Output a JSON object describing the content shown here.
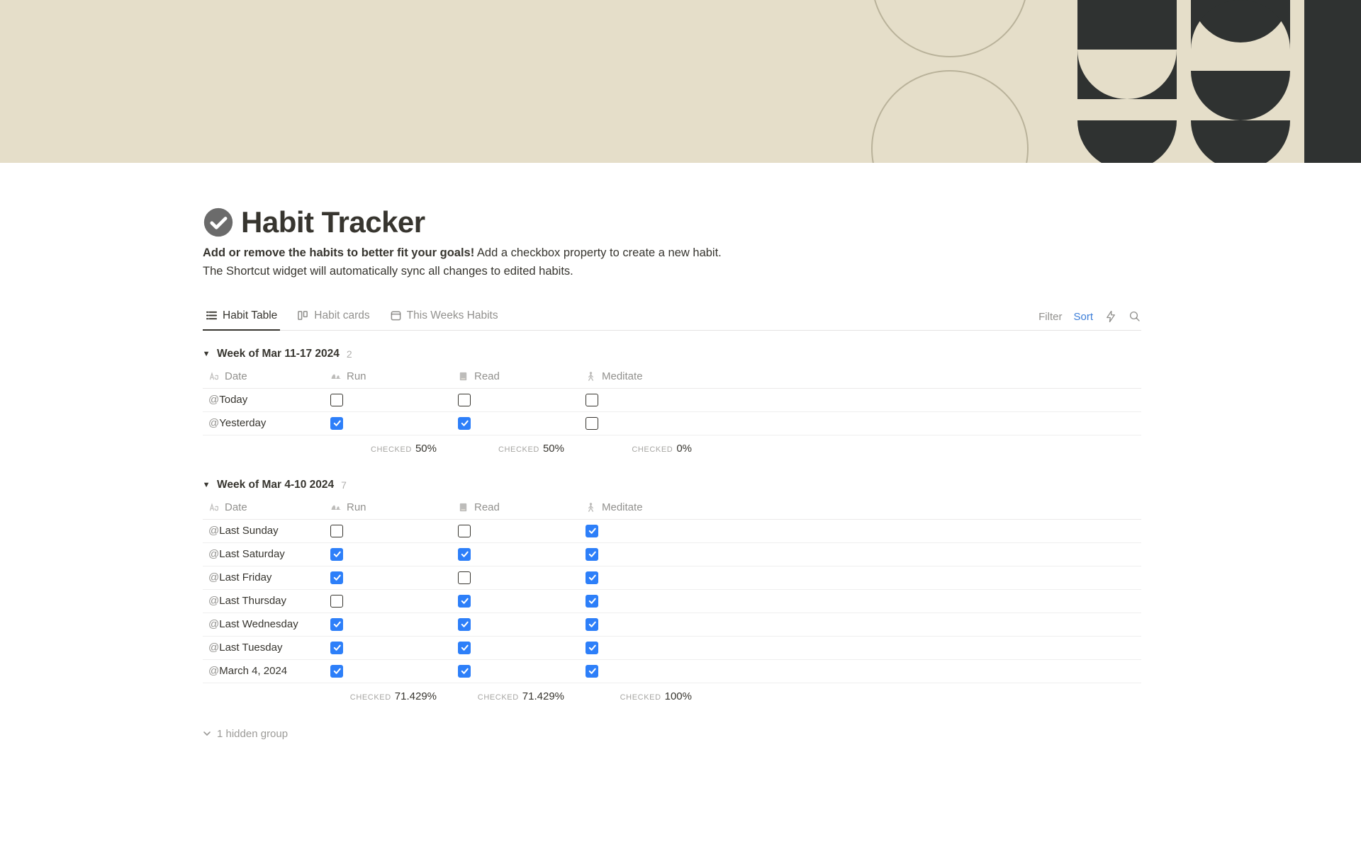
{
  "page": {
    "title": "Habit Tracker",
    "desc_bold": "Add or remove the habits to better fit your goals!",
    "desc_rest": " Add a checkbox property to create a new habit.",
    "desc_line2": "The Shortcut widget will automatically sync all changes to edited habits."
  },
  "tabs": [
    {
      "label": "Habit Table",
      "active": true,
      "icon": "list"
    },
    {
      "label": "Habit cards",
      "active": false,
      "icon": "board"
    },
    {
      "label": "This Weeks Habits",
      "active": false,
      "icon": "calendar"
    }
  ],
  "actions": {
    "filter": "Filter",
    "sort": "Sort"
  },
  "columns": {
    "date": "Date",
    "run": "Run",
    "read": "Read",
    "meditate": "Meditate"
  },
  "summary_label": "CHECKED",
  "hidden_group_text": "1 hidden group",
  "groups": [
    {
      "title": "Week of Mar 11-17 2024",
      "count": "2",
      "rows": [
        {
          "date": "Today",
          "run": false,
          "read": false,
          "meditate": false
        },
        {
          "date": "Yesterday",
          "run": true,
          "read": true,
          "meditate": false
        }
      ],
      "summary": {
        "run": "50%",
        "read": "50%",
        "meditate": "0%"
      }
    },
    {
      "title": "Week of Mar 4-10 2024",
      "count": "7",
      "rows": [
        {
          "date": "Last Sunday",
          "run": false,
          "read": false,
          "meditate": true
        },
        {
          "date": "Last Saturday",
          "run": true,
          "read": true,
          "meditate": true
        },
        {
          "date": "Last Friday",
          "run": true,
          "read": false,
          "meditate": true
        },
        {
          "date": "Last Thursday",
          "run": false,
          "read": true,
          "meditate": true
        },
        {
          "date": "Last Wednesday",
          "run": true,
          "read": true,
          "meditate": true
        },
        {
          "date": "Last Tuesday",
          "run": true,
          "read": true,
          "meditate": true
        },
        {
          "date": "March 4, 2024",
          "run": true,
          "read": true,
          "meditate": true
        }
      ],
      "summary": {
        "run": "71.429%",
        "read": "71.429%",
        "meditate": "100%"
      }
    }
  ]
}
